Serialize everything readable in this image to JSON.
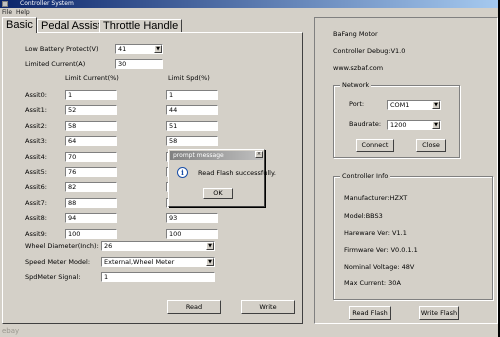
{
  "window": {
    "title": "Controller System",
    "menu": [
      "File",
      "Help"
    ]
  },
  "tabs": [
    "Basic",
    "Pedal Assist",
    "Throttle Handle"
  ],
  "basic": {
    "low_battery_label": "Low Battery Protect(V)",
    "low_battery_value": "41",
    "limited_current_label": "Limited Current(A)",
    "limited_current_value": "30",
    "limit_current_header": "Limit Current(%)",
    "limit_spd_header": "Limit Spd(%)",
    "assist_rows": [
      {
        "label": "Assit0:",
        "current": "1",
        "speed": "1"
      },
      {
        "label": "Assit1:",
        "current": "52",
        "speed": "44"
      },
      {
        "label": "Assit2:",
        "current": "58",
        "speed": "51"
      },
      {
        "label": "Assit3:",
        "current": "64",
        "speed": "58"
      },
      {
        "label": "Assit4:",
        "current": "70",
        "speed": "6"
      },
      {
        "label": "Assit5:",
        "current": "76",
        "speed": "7"
      },
      {
        "label": "Assit6:",
        "current": "82",
        "speed": "7"
      },
      {
        "label": "Assit7:",
        "current": "88",
        "speed": "8"
      },
      {
        "label": "Assit8:",
        "current": "94",
        "speed": "93"
      },
      {
        "label": "Assit9:",
        "current": "100",
        "speed": "100"
      }
    ],
    "wheel_diameter_label": "Wheel Diameter(Inch):",
    "wheel_diameter_value": "26",
    "speed_meter_model_label": "Speed Meter Model:",
    "speed_meter_model_value": "External,Wheel Meter",
    "spdmeter_signal_label": "SpdMeter Signal:",
    "spdmeter_signal_value": "1",
    "read_label": "Read",
    "write_label": "Write"
  },
  "info": {
    "company": "BaFang Motor",
    "debug_version": "Controller Debug:V1.0",
    "website": "www.szbaf.com",
    "network_title": "Network",
    "port_label": "Port:",
    "port_value": "COM1",
    "baudrate_label": "Baudrate:",
    "baudrate_value": "1200",
    "connect_label": "Connect",
    "close_label": "Close",
    "controller_info_title": "Controller Info",
    "manufacturer": "Manufacturer:HZXT",
    "model": "Model:BBS3",
    "hardware_ver": "Hareware Ver: V1.1",
    "firmware_ver": "Firmware Ver: V0.0.1.1",
    "nominal_voltage": "Nominal Voltage: 48V",
    "max_current": "Max Current: 30A",
    "read_flash_label": "Read Flash",
    "write_flash_label": "Write Flash"
  },
  "dialog": {
    "title": "prompt message",
    "message": "Read Flash successfully.",
    "ok_label": "OK",
    "close_glyph": "×",
    "icon_glyph": "i"
  },
  "arrow_glyph": "▼",
  "watermark": "ebay"
}
